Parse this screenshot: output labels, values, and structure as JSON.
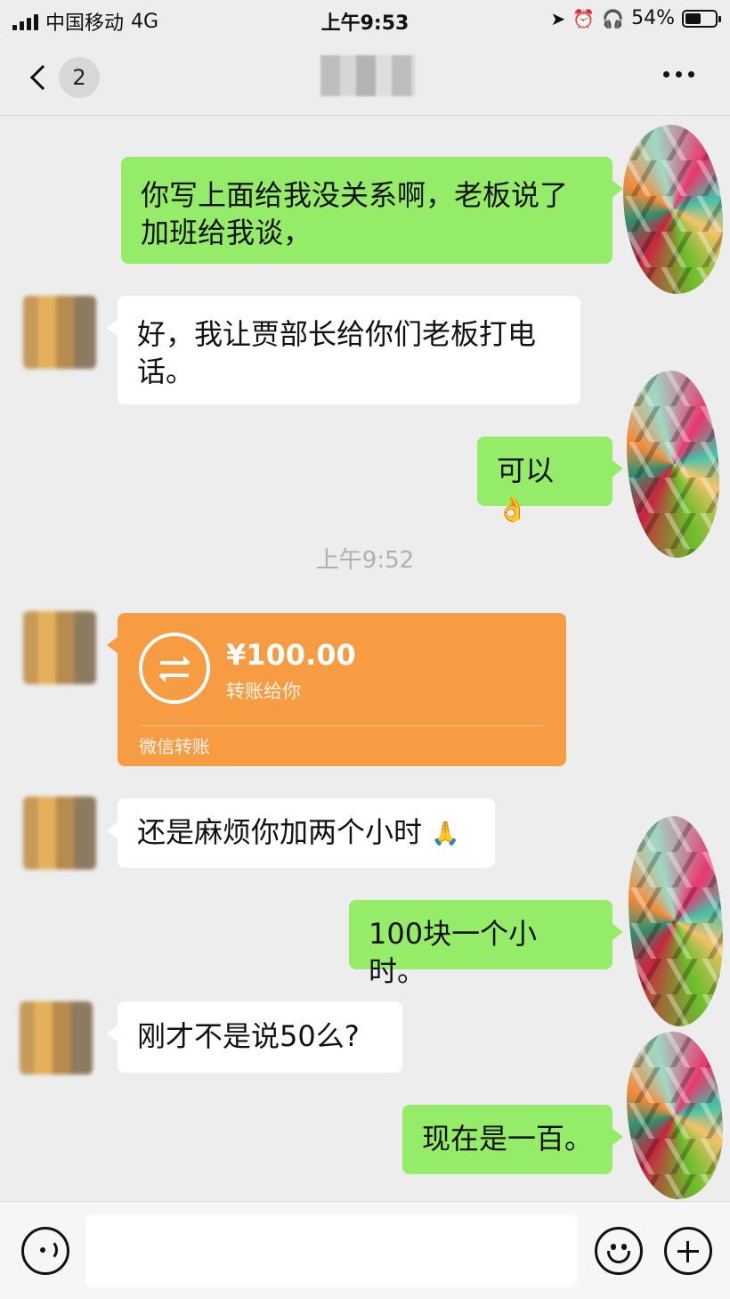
{
  "status_bar": {
    "carrier": "中国移动",
    "network": "4G",
    "time": "上午9:53",
    "battery": "54%",
    "battery_level": 0.54
  },
  "nav": {
    "unread_count": "2"
  },
  "messages": [
    {
      "text": "你写上面给我没关系啊，老板说了加班给我谈，"
    },
    {
      "text": "好，我让贾部长给你们老板打电话。"
    },
    {
      "text": "可以",
      "emoji": "👌"
    },
    {
      "text": "还是麻烦你加两个小时",
      "emoji": "🙏"
    },
    {
      "text": "100块一个小时。"
    },
    {
      "text": "刚才不是说50么?"
    },
    {
      "text": "现在是一百。"
    }
  ],
  "timestamp": "上午9:52",
  "transfer": {
    "amount": "¥100.00",
    "subtitle": "转账给你",
    "footer": "微信转账"
  }
}
